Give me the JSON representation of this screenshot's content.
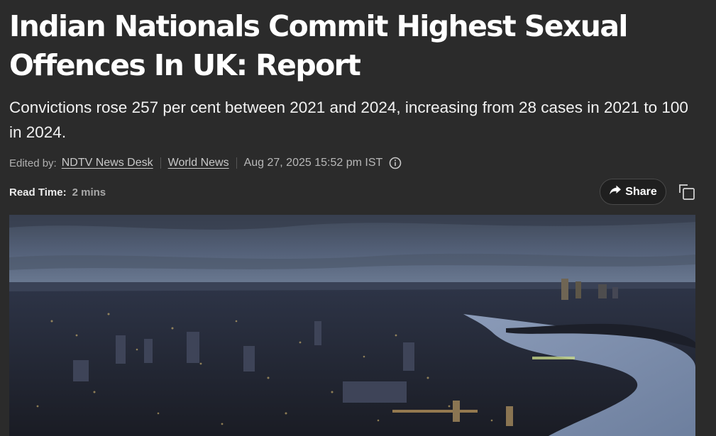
{
  "article": {
    "headline": "Indian Nationals Commit Highest Sexual Offences In UK: Report",
    "subheadline": "Convictions rose 257 per cent between 2021 and 2024, increasing from 28 cases in 2021 to 100 in 2024.",
    "meta": {
      "edited_by_label": "Edited by:",
      "editor": "NDTV News Desk",
      "category": "World News",
      "date": "Aug 27, 2025 15:52 pm IST",
      "info_icon": "info-circle-icon"
    },
    "read_time": {
      "label": "Read Time:",
      "value": "2 mins"
    },
    "actions": {
      "share_label": "Share",
      "share_icon": "share-arrow-icon",
      "copy_icon": "copy-icon"
    },
    "hero_image": {
      "subject": "aerial-city-night-river-icon"
    }
  },
  "colors": {
    "background": "#2b2b2b",
    "text": "#ffffff",
    "meta_text": "#b8b8b8",
    "share_button_bg": "#1f1f1f"
  }
}
